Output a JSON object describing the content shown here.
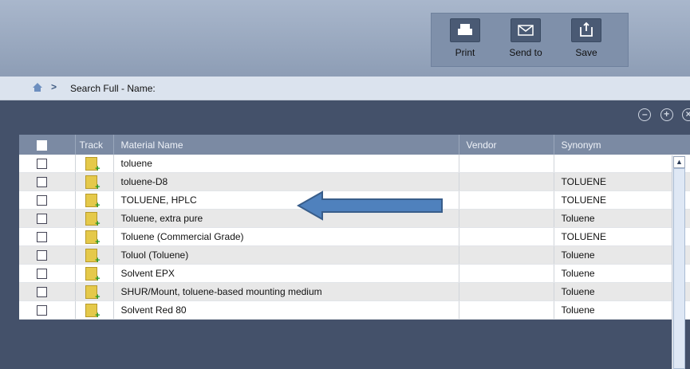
{
  "toolbar": {
    "print_label": "Print",
    "send_label": "Send to",
    "save_label": "Save"
  },
  "breadcrumb": {
    "separator": ">",
    "text": "Search Full - Name:"
  },
  "table": {
    "headers": {
      "track": "Track",
      "material": "Material Name",
      "vendor": "Vendor",
      "synonym": "Synonym"
    },
    "rows": [
      {
        "material": "toluene",
        "vendor": "",
        "synonym": ""
      },
      {
        "material": "toluene-D8",
        "vendor": "",
        "synonym": "TOLUENE"
      },
      {
        "material": "TOLUENE, HPLC",
        "vendor": "",
        "synonym": "TOLUENE"
      },
      {
        "material": "Toluene, extra pure",
        "vendor": "",
        "synonym": "Toluene"
      },
      {
        "material": "Toluene (Commercial Grade)",
        "vendor": "",
        "synonym": "TOLUENE"
      },
      {
        "material": "Toluol (Toluene)",
        "vendor": "",
        "synonym": "Toluene"
      },
      {
        "material": "Solvent EPX",
        "vendor": "",
        "synonym": "Toluene"
      },
      {
        "material": "SHUR/Mount, toluene-based mounting medium",
        "vendor": "",
        "synonym": "Toluene"
      },
      {
        "material": "Solvent Red 80",
        "vendor": "",
        "synonym": "Toluene"
      }
    ]
  },
  "colors": {
    "panel": "#44516a",
    "header": "#7b8aa3",
    "arrow": "#4f81bd"
  }
}
